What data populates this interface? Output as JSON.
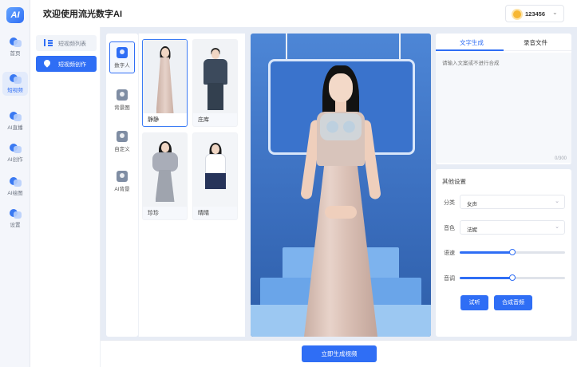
{
  "app": {
    "logo_text": "AI",
    "title": "欢迎使用流光数字AI",
    "user_id": "123456",
    "user_chevron": "⌄"
  },
  "rail": {
    "items": [
      {
        "label": "首页",
        "active": false
      },
      {
        "label": "短视频",
        "active": true
      },
      {
        "label": "AI直播",
        "active": false
      },
      {
        "label": "AI创作",
        "active": false
      },
      {
        "label": "AI绘图",
        "active": false
      },
      {
        "label": "设置",
        "active": false
      }
    ]
  },
  "subnav": {
    "items": [
      {
        "label": "短视频列表",
        "icon": "list-icon",
        "active": false
      },
      {
        "label": "短视频创作",
        "icon": "pin-icon",
        "active": true
      }
    ]
  },
  "categories": [
    {
      "label": "数字人",
      "icon": "person-icon",
      "active": true
    },
    {
      "label": "背景图",
      "icon": "image-icon",
      "active": false
    },
    {
      "label": "自定义",
      "icon": "edit-icon",
      "active": false
    },
    {
      "label": "AI背景",
      "icon": "ai-image-icon",
      "active": false
    }
  ],
  "avatars": [
    {
      "name": "静静",
      "selected": true
    },
    {
      "name": "庄库",
      "selected": false
    },
    {
      "name": "珍珍",
      "selected": false
    },
    {
      "name": "晴晴",
      "selected": false
    }
  ],
  "text_panel": {
    "tabs": [
      "文字生成",
      "录音文件"
    ],
    "active_tab": 0,
    "placeholder": "请输入文案或不进行合成",
    "counter": "0/300"
  },
  "settings": {
    "title": "其他设置",
    "category_label": "分类",
    "category_value": "女声",
    "voice_label": "音色",
    "voice_value": "法妮",
    "chevron": "⌄",
    "speed_label": "语速",
    "speed_value": 0.5,
    "pitch_label": "音调",
    "pitch_value": 0.5,
    "listen_button": "试听",
    "synthesize_button": "合成音频"
  },
  "bottom": {
    "generate_button": "立即生成视频"
  },
  "colors": {
    "accent": "#2f6ef5",
    "canvas_bg": "#e7ecf5"
  }
}
